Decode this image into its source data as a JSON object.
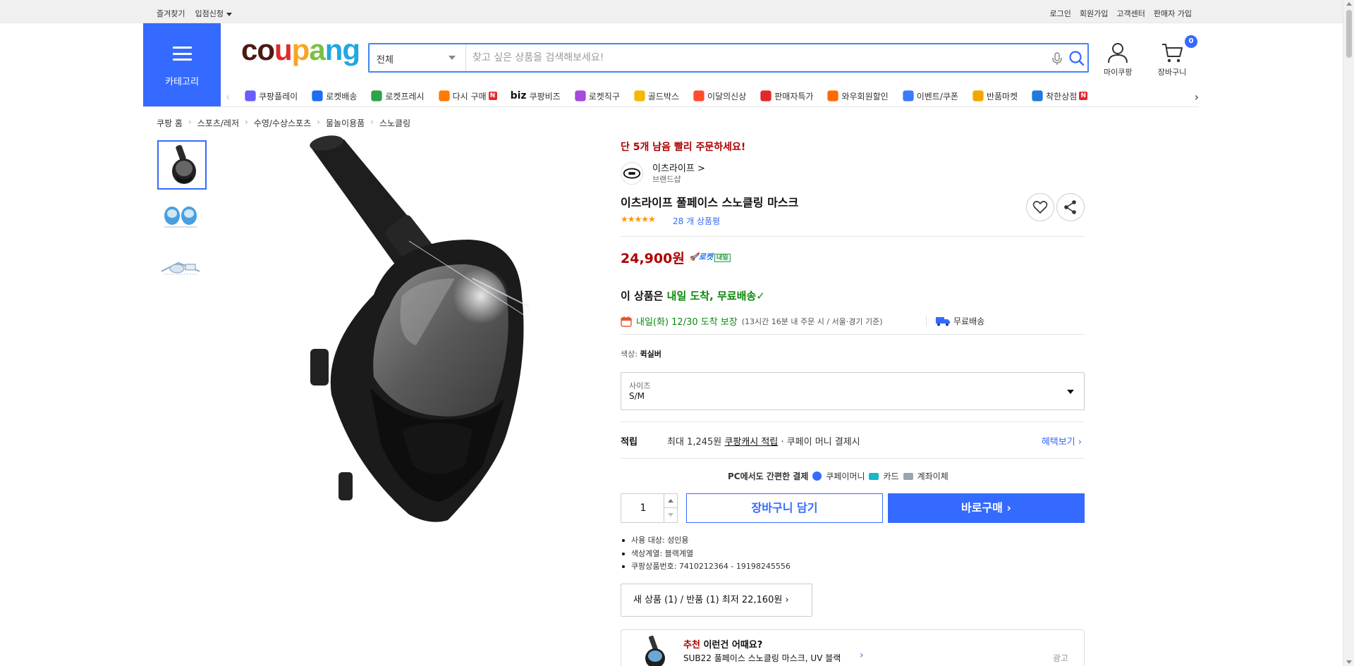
{
  "topbar": {
    "favorites": "즐겨찾기",
    "store_apply": "입점신청",
    "login": "로그인",
    "signup": "회원가입",
    "support": "고객센터",
    "seller_signup": "판매자 가입"
  },
  "header": {
    "category_label": "카테고리",
    "logo": [
      "c",
      "o",
      "u",
      "p",
      "a",
      "n",
      "g"
    ],
    "logo_colors": [
      "#4b1a11",
      "#4b1a11",
      "#e02a2a",
      "#f5a623",
      "#7ac142",
      "#22a7e0",
      "#22a7e0"
    ],
    "search_scope": "전체",
    "search_placeholder": "찾고 싶은 상품을 검색해보세요!",
    "mypage": "마이쿠팡",
    "cart": "장바구니",
    "cart_count": "0"
  },
  "nav": {
    "items": [
      {
        "label": "쿠팡플레이",
        "icon": "play-icon",
        "color": "#6a5cff"
      },
      {
        "label": "로켓배송",
        "icon": "rocket-icon",
        "color": "#1d6ef2"
      },
      {
        "label": "로켓프레시",
        "icon": "rocket-fresh-icon",
        "color": "#2fa24a"
      },
      {
        "label": "다시 구매",
        "icon": "rebuy-icon",
        "color": "#ff7a00",
        "badge": "N"
      },
      {
        "label": "쿠팡비즈",
        "icon": "biz-icon",
        "color": "#e02a2a",
        "prefix": "biz"
      },
      {
        "label": "로켓직구",
        "icon": "direct-buy-icon",
        "color": "#a64bdc"
      },
      {
        "label": "골드박스",
        "icon": "goldbox-icon",
        "color": "#f5b800"
      },
      {
        "label": "이달의신상",
        "icon": "new-icon",
        "color": "#ff4d2e"
      },
      {
        "label": "판매자특가",
        "icon": "seller-deal-icon",
        "color": "#e02a2a"
      },
      {
        "label": "와우회원할인",
        "icon": "wow-icon",
        "color": "#ff6a00"
      },
      {
        "label": "이벤트/쿠폰",
        "icon": "coupon-icon",
        "color": "#3a7bff"
      },
      {
        "label": "반품마켓",
        "icon": "return-market-icon",
        "color": "#f0a800"
      },
      {
        "label": "착한상점",
        "icon": "good-store-icon",
        "color": "#1f7adc",
        "badge": "N"
      }
    ]
  },
  "breadcrumb": [
    "쿠팡 홈",
    "스포츠/레저",
    "수영/수상스포츠",
    "물놀이용품",
    "스노클링"
  ],
  "product": {
    "stock_alert": "단 5개 남음 빨리 주문하세요!",
    "brand": "이츠라이프",
    "brand_chevron": ">",
    "brand_sub": "브랜드샵",
    "title": "이츠라이프 풀페이스 스노클링 마스크",
    "stars": "★★★★★",
    "reviews": "28 개 상품평",
    "price": "24,900원",
    "rocket_label": "로켓",
    "rocket_tag": "내일",
    "arrival_prefix": "이 상품은 ",
    "arrival_green": "내일 도착, 무료배송",
    "arrival_check": "✓",
    "delivery_main": "내일(화) 12/30 도착 보장",
    "delivery_note": "(13시간 16분 내 주문 시 / 서울·경기 기준)",
    "free_shipping": "무료배송",
    "color_key": "색상: ",
    "color_value": "퀵실버",
    "size_label": "사이즈",
    "size_value": "S/M",
    "points_key": "적립",
    "points_text1": "최대 1,245원 ",
    "points_link": "쿠팡캐시 적립",
    "points_text2": " · 쿠페이 머니 결제시",
    "points_more": "혜택보기 ›",
    "pay_msg": "PC에서도 간편한 결제",
    "pay_methods": [
      "쿠페이머니",
      "카드",
      "계좌이체"
    ],
    "quantity": "1",
    "add_to_cart": "장바구니 담기",
    "buy_now": "바로구매 ›",
    "specs": [
      "사용 대상: 성인용",
      "색상계열: 블랙계열",
      "쿠팡상품번호: 7410212364 - 19198245556"
    ],
    "used_offer": "새 상품 (1) / 반품 (1) 최저 22,160원 ›",
    "reco_red": "추천",
    "reco_rest": " 이런건 어때요?",
    "reco_item": "SUB22 풀페이스 스노클링 마스크, UV 블랙",
    "reco_ad": "광고"
  },
  "colors": {
    "accent": "#346aff",
    "price": "#ae0000",
    "green": "#0a8a0a"
  }
}
